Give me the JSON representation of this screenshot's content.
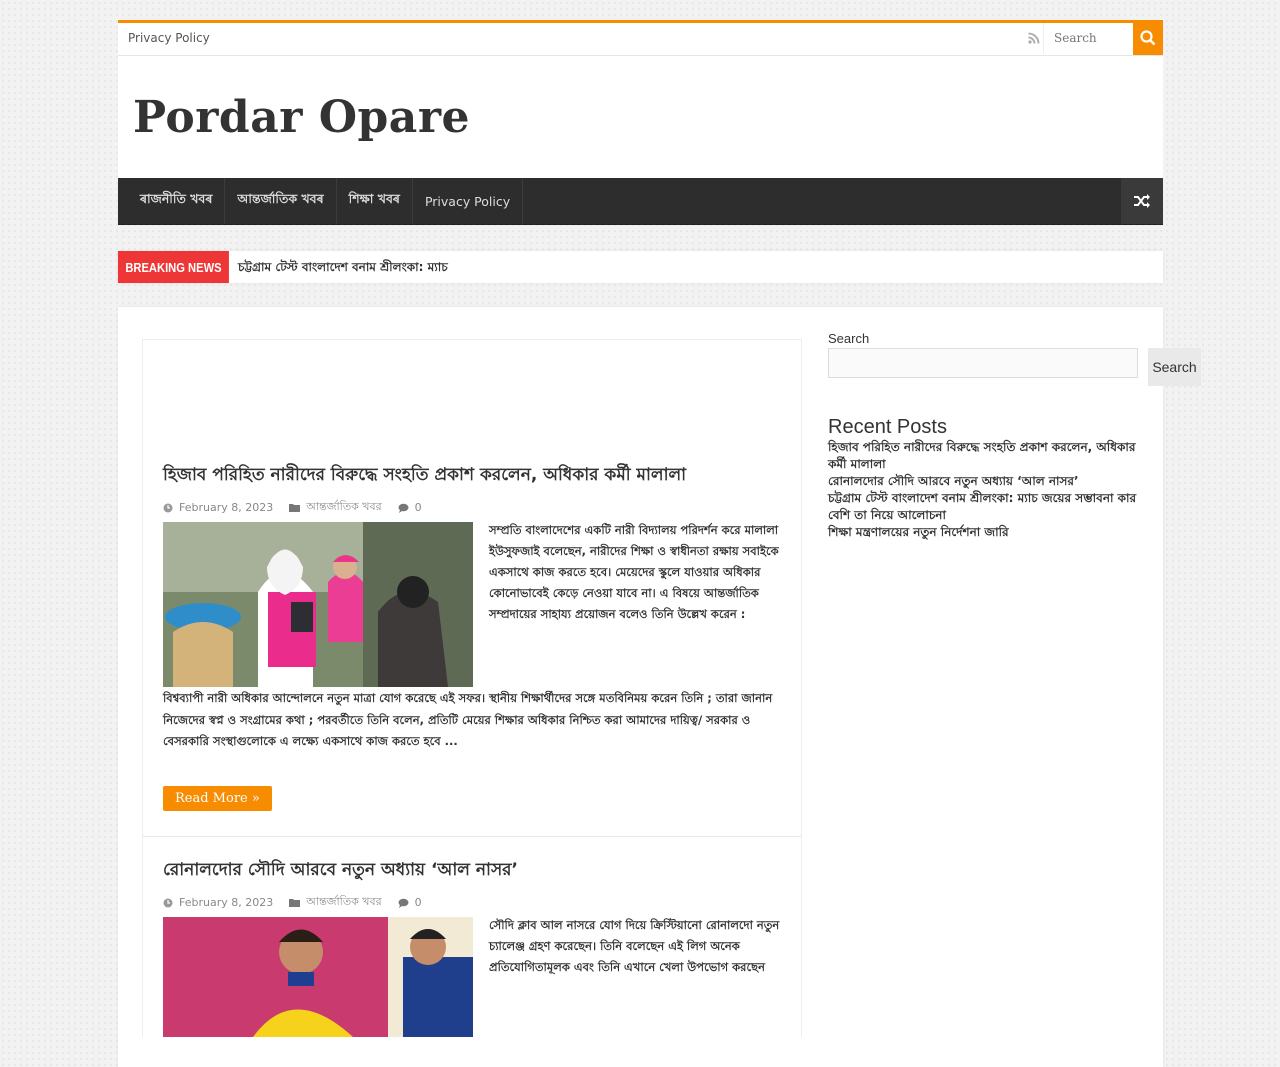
{
  "topbar": {
    "nav_link": "Privacy Policy",
    "search_placeholder": "Search"
  },
  "site": {
    "title": "Pordar Opare"
  },
  "mainnav": {
    "items": [
      {
        "label": "ৰাজনীতি খবৰ",
        "en": false
      },
      {
        "label": "আন্তর্জাতিক খবৰ",
        "en": false
      },
      {
        "label": "শিক্ষা খবৰ",
        "en": false
      },
      {
        "label": "Privacy Policy",
        "en": true
      }
    ]
  },
  "breaking": {
    "label": "BREAKING NEWS",
    "headline": "চট্টগ্রাম টেস্ট বাংলাদেশ বনাম শ্রীলংকা: ম্যাচ"
  },
  "posts": [
    {
      "title": "হিজাব পরিহিত নারীদের বিরুদ্ধে সংহতি প্রকাশ করলেন, অধিকার কর্মী মালালা",
      "date": "February 8, 2023",
      "category": "আন্তর্জাতিক খবর",
      "comments": "0",
      "excerpt_side": "সম্প্রতি বাংলাদেশের একটি নারী বিদ্যালয় পরিদর্শন করে মালালা ইউসুফজাই বলেছেন, নারীদের শিক্ষা ও স্বাধীনতা রক্ষায় সবাইকে একসাথে কাজ করতে হবে। মেয়েদের স্কুলে যাওয়ার অধিকার কোনোভাবেই কেড়ে নেওয়া যাবে না। এ বিষয়ে আন্তর্জাতিক সম্প্রদায়ের সাহায্য প্রয়োজন বলেও তিনি উল্লেখ করেন : ",
      "excerpt_full": "বিশ্বব্যাপী নারী অধিকার আন্দোলনে নতুন মাত্রা যোগ করেছে এই সফর। স্থানীয় শিক্ষার্থীদের সঙ্গে মতবিনিময় করেন তিনি ; তারা জানান নিজেদের স্বপ্ন ও সংগ্রামের কথা ; পরবর্তীতে তিনি বলেন, প্রতিটি মেয়ের শিক্ষার অধিকার নিশ্চিত করা আমাদের দায়িত্ব/ সরকার ও বেসরকারি সংস্থাগুলোকে এ লক্ষ্যে একসাথে কাজ করতে হবে ...",
      "read_more": "Read More »"
    },
    {
      "title": "রোনালদোর সৌদি আরবে নতুন অধ্যায় ‘আল নাসর’",
      "date": "February 8, 2023",
      "category": "আন্তর্জাতিক খবর",
      "comments": "0",
      "excerpt_side": "সৌদি ক্লাব আল নাসরে যোগ দিয়ে ক্রিস্টিয়ানো রোনালদো নতুন চ্যালেঞ্জ গ্রহণ করেছেন। তিনি বলেছেন এই লিগ অনেক প্রতিযোগিতামূলক এবং তিনি এখানে খেলা উপভোগ করছেন"
    }
  ],
  "sidebar": {
    "search_label": "Search",
    "search_button": "Search",
    "recent_title": "Recent Posts",
    "recent_posts": [
      "হিজাব পরিহিত নারীদের বিরুদ্ধে সংহতি প্রকাশ করলেন, অধিকার কর্মী মালালা",
      "রোনালদোর সৌদি আরবে নতুন অধ্যায় ‘আল নাসর’",
      "চট্টগ্রাম টেস্ট বাংলাদেশ বনাম শ্রীলংকা: ম্যাচ জয়ের সম্ভাবনা কার বেশি তা নিয়ে আলোচনা",
      "শিক্ষা মন্ত্রণালয়ের নতুন নির্দেশনা জারি"
    ]
  },
  "colors": {
    "accent": "#f88c00",
    "breaking": "#ef3636",
    "nav": "#2d2d2d"
  }
}
